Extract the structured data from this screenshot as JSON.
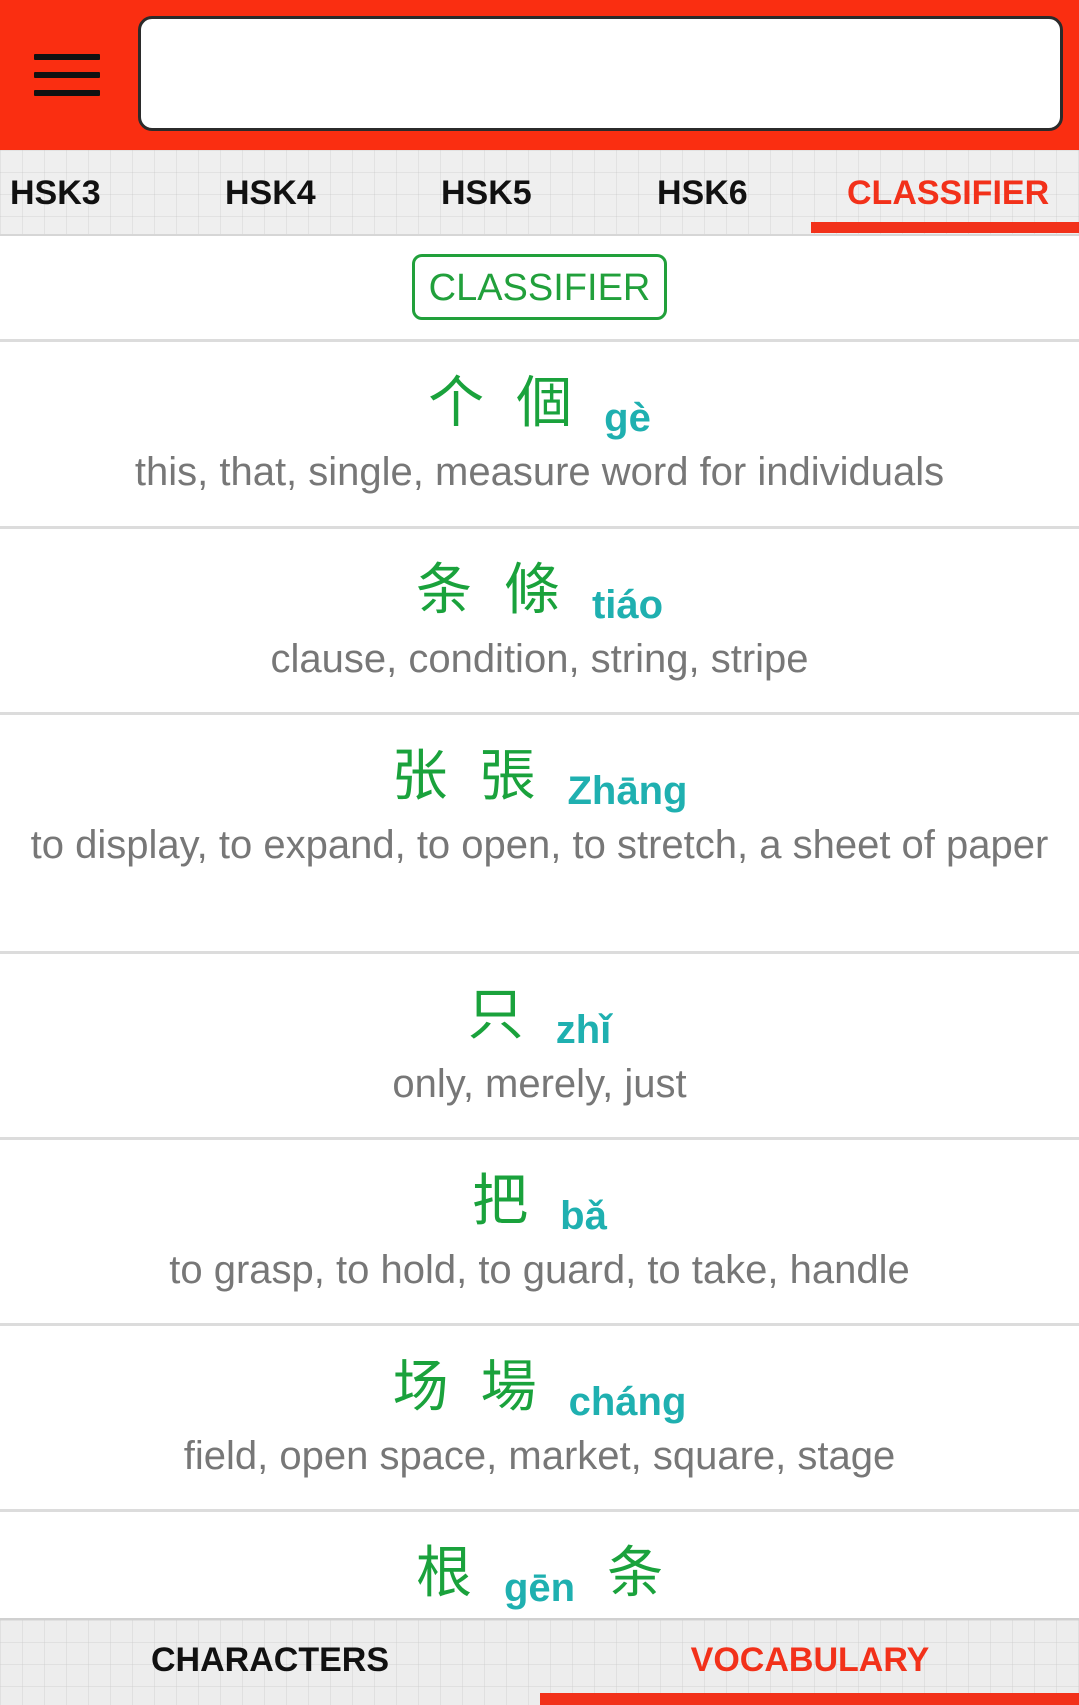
{
  "app_bar": {
    "menu_icon": "hamburger-menu-icon",
    "search_value": "",
    "search_placeholder": ""
  },
  "top_tabs": [
    {
      "label": "HSK3"
    },
    {
      "label": "HSK4"
    },
    {
      "label": "HSK5"
    },
    {
      "label": "HSK6"
    },
    {
      "label": "CLASSIFIER",
      "active": true
    }
  ],
  "section": {
    "title": "CLASSIFIER"
  },
  "entries": [
    {
      "chars": [
        "个",
        "個"
      ],
      "pinyin": "gè",
      "meaning": "this,  that,  single,  measure word for individuals"
    },
    {
      "chars": [
        "条",
        "條"
      ],
      "pinyin": "tiáo",
      "meaning": "clause,  condition,  string,  stripe"
    },
    {
      "chars": [
        "张",
        "張"
      ],
      "pinyin": "Zhāng",
      "meaning": "to display,  to expand,  to open,  to stretch,  a sheet of paper"
    },
    {
      "chars": [
        "只"
      ],
      "pinyin": "zhǐ",
      "meaning": "only,  merely,  just"
    },
    {
      "chars": [
        "把"
      ],
      "pinyin": "bǎ",
      "meaning": "to grasp,  to hold,  to guard,  to take,  handle"
    },
    {
      "chars": [
        "场",
        "場"
      ],
      "pinyin": "cháng",
      "meaning": "field,  open space,  market,  square,  stage"
    },
    {
      "chars": [
        "根"
      ],
      "pinyin": "gēn",
      "chars_after": [
        "条"
      ],
      "meaning": ""
    }
  ],
  "bottom_tabs": [
    {
      "label": "CHARACTERS"
    },
    {
      "label": "VOCABULARY",
      "active": true
    }
  ],
  "colors": {
    "app_bar": "#fa2e11",
    "accent": "#f2311a",
    "hanzi": "#1aa23c",
    "pinyin": "#1fb0b0",
    "meaning": "#777777"
  }
}
